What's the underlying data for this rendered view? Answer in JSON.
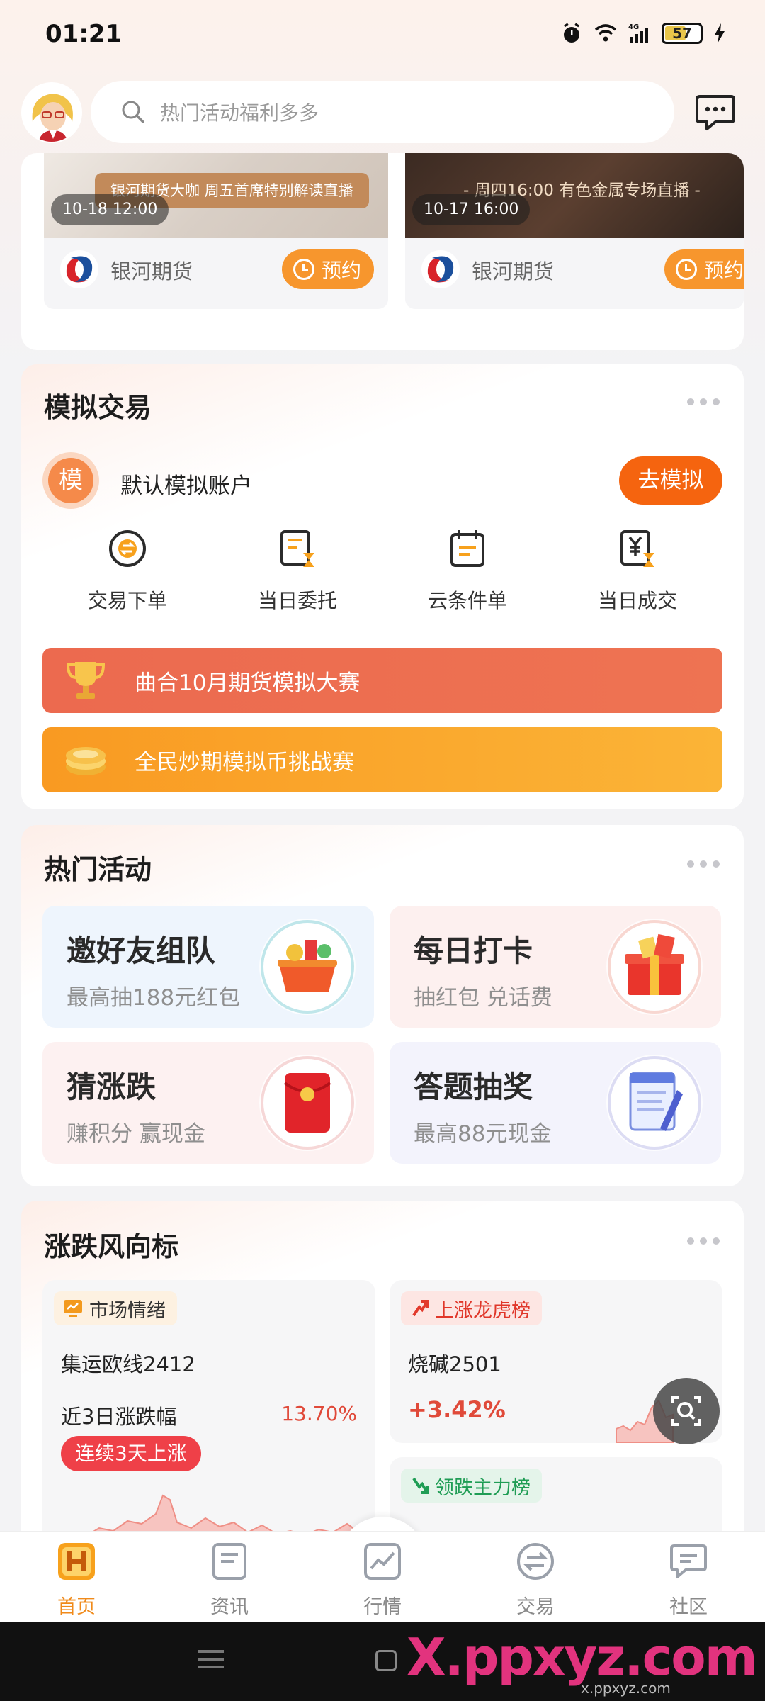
{
  "status_bar": {
    "time": "01:21",
    "battery": "57"
  },
  "header": {
    "search_placeholder": "热门活动福利多多"
  },
  "live": {
    "items": [
      {
        "banner": "银河期货大咖  周五首席特别解读直播",
        "time": "10-18 12:00",
        "brand": "银河期货",
        "button": "预约"
      },
      {
        "banner": "- 周四16:00 有色金属专场直播 -",
        "time": "10-17 16:00",
        "brand": "银河期货",
        "button": "预约"
      }
    ]
  },
  "sim_trade": {
    "title": "模拟交易",
    "avatar_char": "模",
    "account": "默认模拟账户",
    "go_button": "去模拟",
    "actions": [
      {
        "label": "交易下单",
        "icon": "exchange-icon"
      },
      {
        "label": "当日委托",
        "icon": "order-doc-icon"
      },
      {
        "label": "云条件单",
        "icon": "calendar-doc-icon"
      },
      {
        "label": "当日成交",
        "icon": "yen-doc-icon"
      }
    ],
    "banners": [
      {
        "label": "曲合10月期货模拟大赛",
        "icon": "trophy-icon",
        "color": "#ec6a4f"
      },
      {
        "label": "全民炒期模拟币挑战赛",
        "icon": "coin-icon",
        "color": "#f9a523"
      }
    ]
  },
  "hot_activities": {
    "title": "热门活动",
    "tiles": [
      {
        "title": "邀好友组队",
        "subtitle": "最高抽188元红包",
        "icon": "gift-basket-icon"
      },
      {
        "title": "每日打卡",
        "subtitle": "抽红包 兑话费",
        "icon": "gift-box-icon"
      },
      {
        "title": "猜涨跌",
        "subtitle": "赚积分 赢现金",
        "icon": "red-envelope-icon"
      },
      {
        "title": "答题抽奖",
        "subtitle": "最高88元现金",
        "icon": "quiz-notepad-icon"
      }
    ]
  },
  "trend": {
    "title": "涨跌风向标",
    "market_mood": {
      "tag": "市场情绪",
      "contract": "集运欧线2412",
      "label": "近3日涨跌幅",
      "value": "13.70%",
      "badge": "连续3天上涨"
    },
    "rise_board": {
      "tag": "上涨龙虎榜",
      "contract": "烧碱2501",
      "value": "+3.42%"
    },
    "fall_board": {
      "tag": "领跌主力榜"
    }
  },
  "bottom_nav": {
    "items": [
      {
        "label": "首页",
        "icon": "home-icon",
        "active": true
      },
      {
        "label": "资讯",
        "icon": "news-icon",
        "active": false
      },
      {
        "label": "行情",
        "icon": "chart-icon",
        "active": false
      },
      {
        "label": "交易",
        "icon": "trade-icon",
        "active": false
      },
      {
        "label": "社区",
        "icon": "community-icon",
        "active": false
      }
    ]
  },
  "watermark": {
    "text": "X.ppxyz.com",
    "sub": "x.ppxyz.com"
  },
  "colors": {
    "accent": "#f5640f",
    "gold": "#f7962d",
    "up_red": "#e04a3a",
    "down_green": "#1f9d55"
  }
}
